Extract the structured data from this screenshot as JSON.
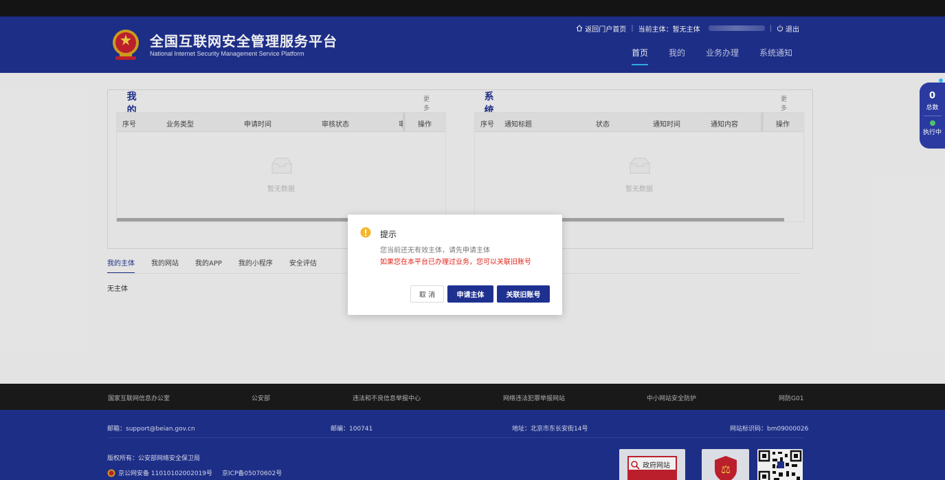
{
  "header": {
    "title": "全国互联网安全管理服务平台",
    "subtitle": "National Internet Security Management Service Platform",
    "topbar": {
      "home_link": "返回门户首页",
      "subject_label": "当前主体：暂无主体",
      "logout": "退出"
    },
    "nav": [
      {
        "label": "首页",
        "active": true
      },
      {
        "label": "我的"
      },
      {
        "label": "业务办理"
      },
      {
        "label": "系统通知"
      }
    ]
  },
  "applications": {
    "title": "我的申请",
    "more": "更多 ››",
    "columns": [
      "序号",
      "业务类型",
      "申请时间",
      "审核状态",
      "审",
      "操作"
    ],
    "empty": "暂无数据"
  },
  "notifications": {
    "title": "系统通知",
    "more": "更多 ››",
    "columns": [
      "序号",
      "通知标题",
      "状态",
      "通知时间",
      "通知内容",
      "操作"
    ],
    "empty": "暂无数据"
  },
  "tabs": [
    {
      "label": "我的主体",
      "active": true
    },
    {
      "label": "我的网站"
    },
    {
      "label": "我的APP"
    },
    {
      "label": "我的小程序"
    },
    {
      "label": "安全评估"
    }
  ],
  "subject_content": "无主体",
  "float_widget": {
    "count": "0",
    "total_label": "总数",
    "running_label": "执行中"
  },
  "footer_links": [
    "国家互联网信息办公室",
    "公安部",
    "违法和不良信息举报中心",
    "网络违法犯罪举报网站",
    "中小网站安全防护",
    "网防G01"
  ],
  "footer": {
    "email": "邮箱：support@beian.gov.cn",
    "postcode": "邮编：100741",
    "address": "地址：北京市东长安街14号",
    "site_id": "网站标识码：bm09000026",
    "copyright": "版权所有：公安部网络安全保卫局",
    "police_record": "京公网安备 11010102002019号",
    "icp_record": "京ICP备05070602号",
    "gov_badge_text": "政府网站"
  },
  "modal": {
    "title": "提示",
    "line1": "您当前还无有效主体，请先申请主体",
    "line2": "如果您在本平台已办理过业务，您可以关联旧账号",
    "cancel": "取 消",
    "apply": "申请主体",
    "link_account": "关联旧账号"
  },
  "colors": {
    "brand": "#1f3190",
    "accent": "#2fb7f5",
    "warning": "#f5b62a",
    "danger": "#e0241b"
  }
}
